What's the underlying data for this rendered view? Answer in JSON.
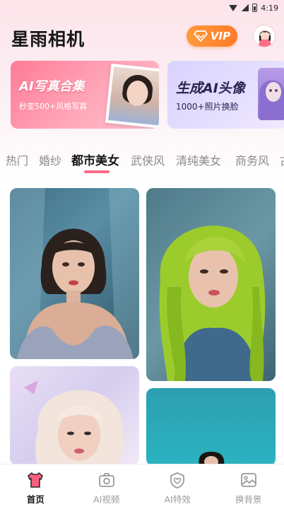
{
  "status": {
    "time": "4:19"
  },
  "header": {
    "title": "星雨相机",
    "vip_label": "VIP"
  },
  "banners": [
    {
      "title": "AI写真合集",
      "subtitle": "秒变500+风格写真"
    },
    {
      "title": "生成AI头像",
      "subtitle": "1000+照片换脸"
    }
  ],
  "tabs": [
    "热门",
    "婚纱",
    "都市美女",
    "武侠风",
    "清纯美女",
    "商务风",
    "古"
  ],
  "active_tab": "都市美女",
  "grid": {
    "cards": [
      {
        "icon": "portrait-dark-hair-photo"
      },
      {
        "icon": "portrait-green-hair-photo"
      },
      {
        "icon": "portrait-pink-hair-photo"
      },
      {
        "icon": "portrait-teal-background-photo"
      }
    ]
  },
  "bottom_nav": [
    {
      "label": "首页",
      "icon": "tshirt-icon",
      "active": true
    },
    {
      "label": "AI视频",
      "icon": "camera-icon",
      "active": false
    },
    {
      "label": "AI特效",
      "icon": "heart-shield-icon",
      "active": false
    },
    {
      "label": "换背景",
      "icon": "image-icon",
      "active": false
    }
  ],
  "colors": {
    "accent": "#ff6b8a",
    "vip": "#ff8a30",
    "nav_active": "#ff5f7e"
  }
}
